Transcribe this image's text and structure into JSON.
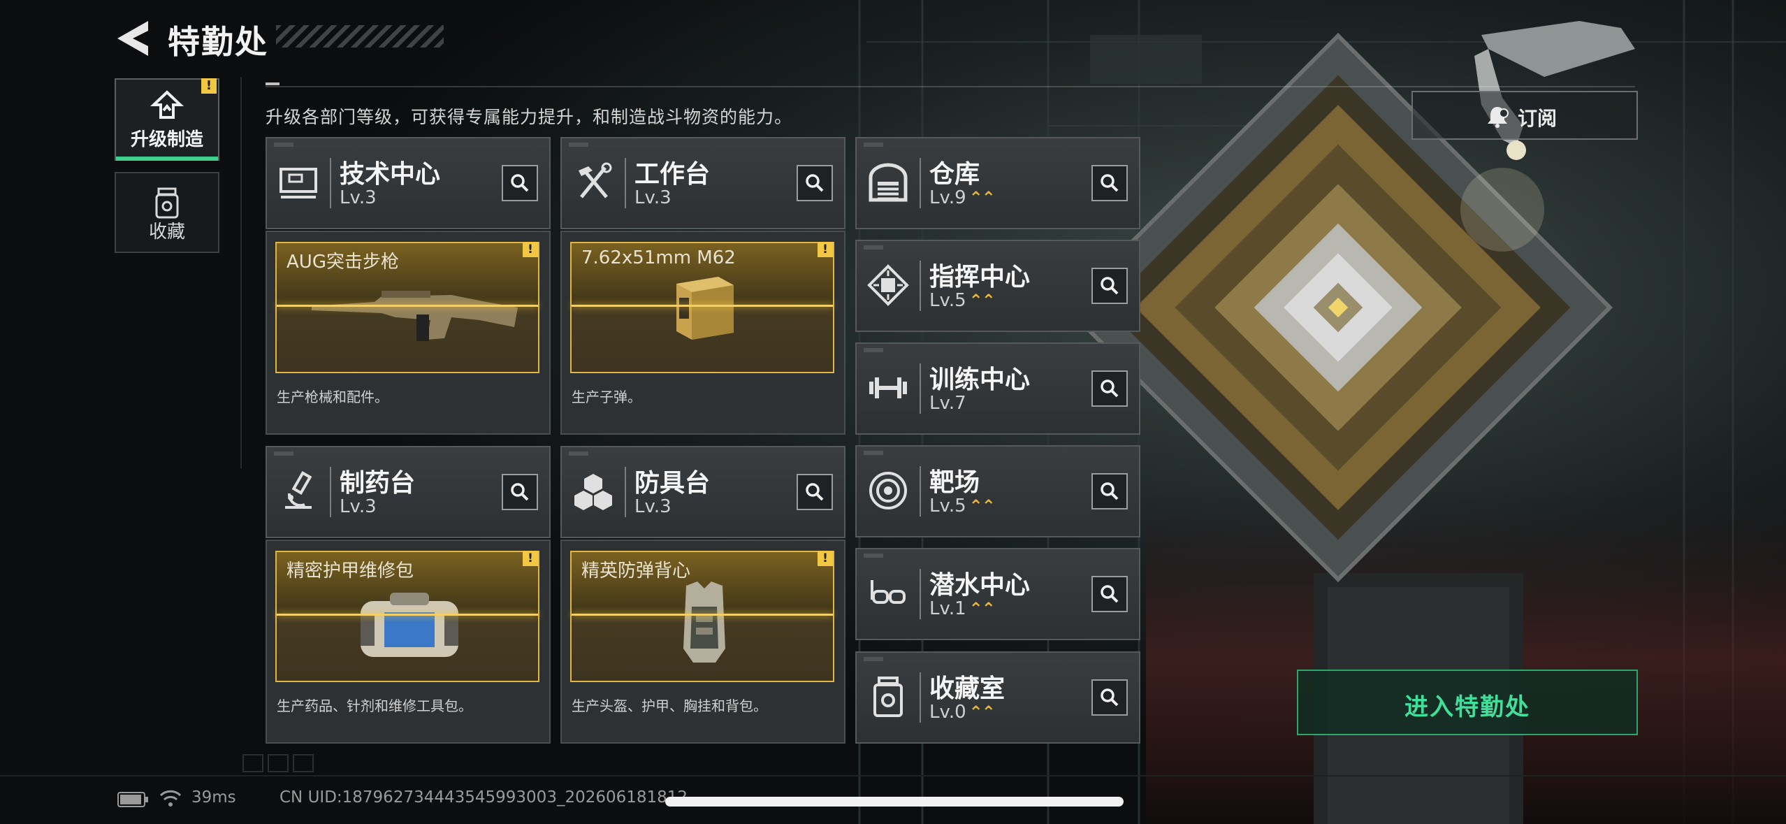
{
  "header": {
    "title": "特勤处"
  },
  "nav": {
    "items": [
      {
        "label": "升级制造",
        "active": true,
        "alert": "!"
      },
      {
        "label": "收藏",
        "active": false
      }
    ]
  },
  "description": "升级各部门等级，可获得专属能力提升，和制造战斗物资的能力。",
  "stations": [
    {
      "name": "技术中心",
      "level": "Lv.3",
      "upgradable": false,
      "icon": "computer-icon",
      "production": {
        "item": "AUG突击步枪",
        "desc": "生产枪械和配件。",
        "alert": "!"
      }
    },
    {
      "name": "工作台",
      "level": "Lv.3",
      "upgradable": false,
      "icon": "tools-icon",
      "production": {
        "item": "7.62x51mm M62",
        "desc": "生产子弹。",
        "alert": "!"
      }
    },
    {
      "name": "制药台",
      "level": "Lv.3",
      "upgradable": false,
      "icon": "microscope-icon",
      "production": {
        "item": "精密护甲维修包",
        "desc": "生产药品、针剂和维修工具包。",
        "alert": "!"
      }
    },
    {
      "name": "防具台",
      "level": "Lv.3",
      "upgradable": false,
      "icon": "armor-boxes-icon",
      "production": {
        "item": "精英防弹背心",
        "desc": "生产头盔、护甲、胸挂和背包。",
        "alert": "!"
      }
    },
    {
      "name": "仓库",
      "level": "Lv.9",
      "upgradable": true,
      "icon": "warehouse-icon"
    },
    {
      "name": "指挥中心",
      "level": "Lv.5",
      "upgradable": true,
      "icon": "command-chip-icon"
    },
    {
      "name": "训练中心",
      "level": "Lv.7",
      "upgradable": false,
      "icon": "dumbbell-icon"
    },
    {
      "name": "靶场",
      "level": "Lv.5",
      "upgradable": true,
      "icon": "target-icon"
    },
    {
      "name": "潜水中心",
      "level": "Lv.1",
      "upgradable": true,
      "icon": "diving-mask-icon"
    },
    {
      "name": "收藏室",
      "level": "Lv.0",
      "upgradable": true,
      "icon": "collection-icon"
    }
  ],
  "upgrade_symbol": "⌃⌃",
  "subscribe_label": "订阅",
  "enter_label": "进入特勤处",
  "status_bar": {
    "ping": "39ms",
    "uid": "CN UID:18796273444354599300​3_202606181812"
  },
  "colors": {
    "accent_green": "#3ed08c",
    "gold": "#e2b645",
    "upgrade": "#e8b73a"
  }
}
